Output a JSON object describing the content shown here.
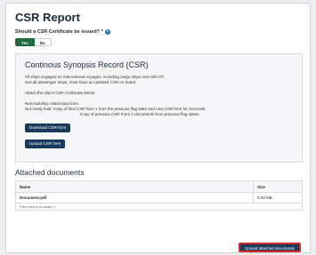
{
  "title": "CSR Report",
  "question": {
    "text": "Should a CSR Certificate be issued? *",
    "help_icon": "help-circle-icon",
    "options": [
      "Yes",
      "No"
    ],
    "selected": "Yes"
  },
  "csr": {
    "heading": "Continous Synopsis Record (CSR)",
    "line1": "All ships engaged on international voyages, including cargo ships over 500 GT,",
    "line2": "and all passenger ships, must have an updated CSR on board.",
    "attach_text": "Attach the ship's CSR Certificate below.",
    "new_building": "New building:  Initial input form",
    "not_newly_built_1": "Not newly built:  Copy of final CSR form 1 from the previous flag state and new CSR form for Denmark.",
    "not_newly_built_2": "Copy of previous CSR Form 1 documents from previous flag states.",
    "download_button": "Download CSR-form",
    "upload_button": "Upload CSR here"
  },
  "attached": {
    "title": "Attached documents",
    "headers": [
      "Name",
      "Size"
    ],
    "rows": [
      {
        "name": "Document.pdf",
        "size": "0.03 MB"
      }
    ],
    "note": "Files ready to be added: 1",
    "upload_button": "Upload attached documents"
  },
  "colors": {
    "accent": "#1a3a5c",
    "yes": "#1e6b3e",
    "highlight": "#d42a2a"
  }
}
